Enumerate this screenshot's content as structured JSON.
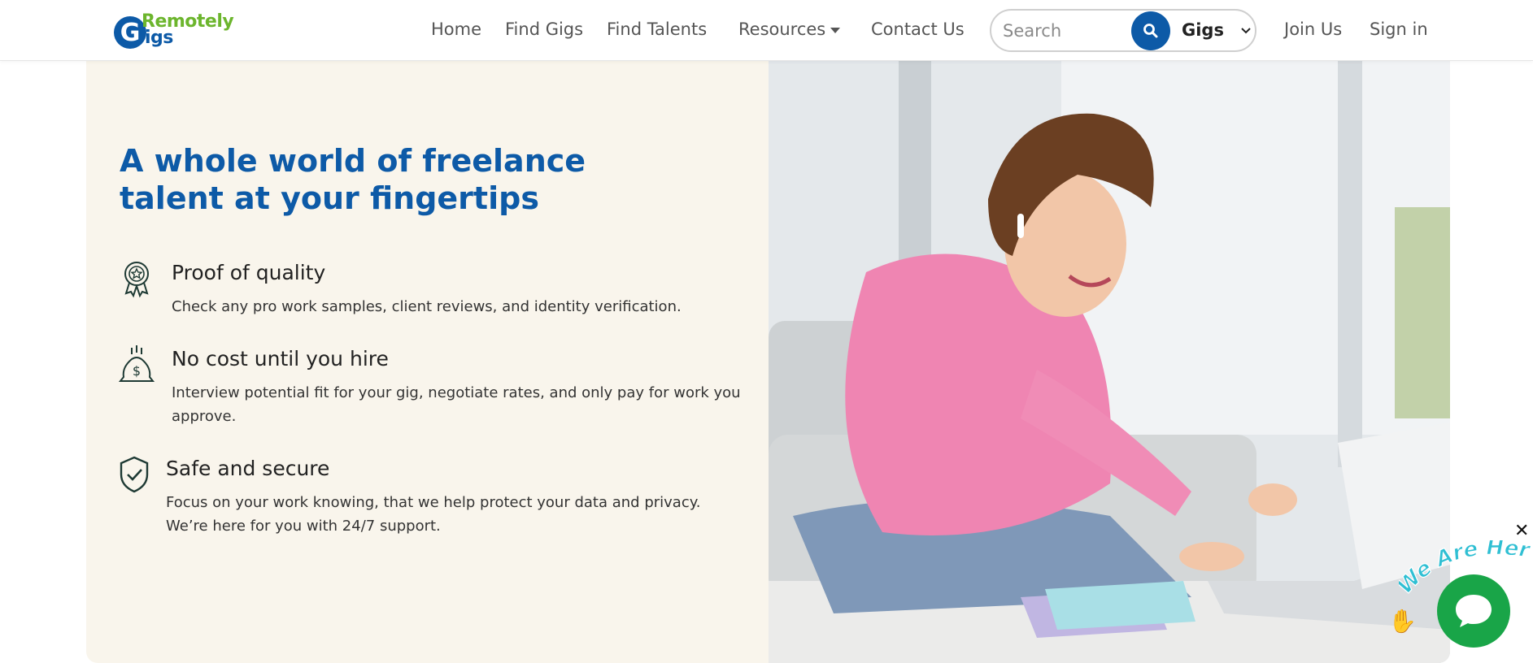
{
  "header": {
    "logo": {
      "top_text": "Remotely",
      "g_letter": "G",
      "bottom_text": "igs"
    },
    "nav": {
      "home": "Home",
      "find_gigs": "Find Gigs",
      "find_talents": "Find Talents",
      "resources": "Resources",
      "contact_us": "Contact Us",
      "join_us": "Join Us",
      "sign_in": "Sign in"
    },
    "search": {
      "placeholder": "Search",
      "scope_value": "Gigs"
    }
  },
  "hero": {
    "title": "A whole world of freelance\ntalent at your fingertips",
    "features": [
      {
        "icon": "award-ribbon-icon",
        "title": "Proof of quality",
        "description": "Check any pro work samples, client reviews, and identity verification."
      },
      {
        "icon": "money-bag-icon",
        "title": "No cost until you hire",
        "description": "Interview potential fit for your gig, negotiate rates, and only pay for work you approve."
      },
      {
        "icon": "shield-check-icon",
        "title": "Safe and secure",
        "description": "Focus on your work knowing, that we help protect your data and privacy. We’re here for you with 24/7 support."
      }
    ]
  },
  "chat_widget": {
    "banner_text": "We Are Here!",
    "close_symbol": "✕"
  },
  "colors": {
    "brand_blue": "#0d5aa7",
    "brand_green": "#6cb52d",
    "panel_bg": "#f9f5ec",
    "chat_green": "#19a548"
  }
}
